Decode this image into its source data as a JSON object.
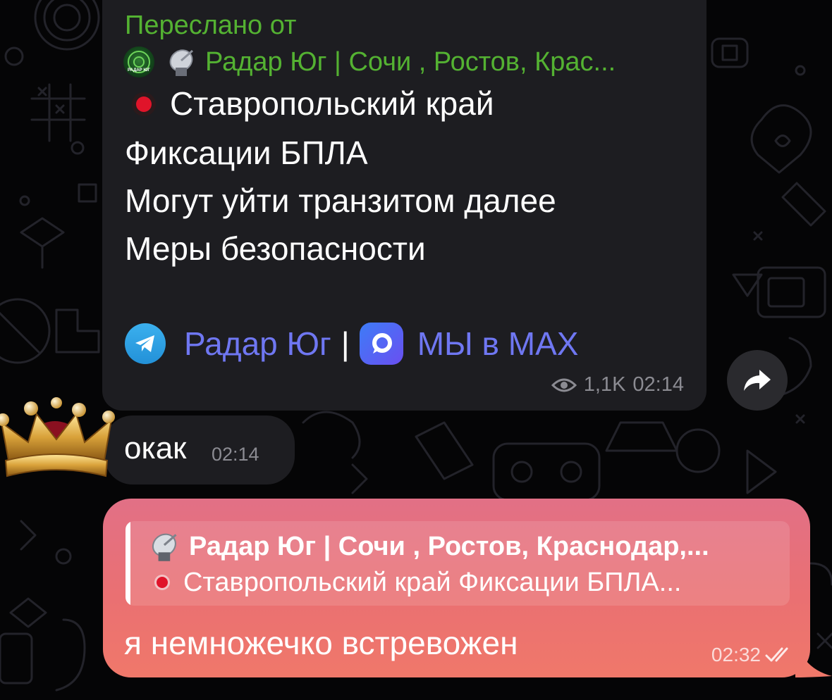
{
  "messages": {
    "forwarded": {
      "forwarded_label": "Переслано от",
      "source_name": "Радар Юг | Сочи , Ростов, Крас...",
      "source_avatar_caption": "РАДАР ЮГ",
      "lines": [
        "Ставропольский край",
        "Фиксации БПЛА",
        "Могут уйти транзитом далее",
        "Меры безопасности"
      ],
      "link_telegram": "Радар Юг",
      "link_separator": "|",
      "link_max": "МЫ в МАХ",
      "views": "1,1K",
      "time": "02:14"
    },
    "incoming_short": {
      "text": "окак",
      "time": "02:14"
    },
    "outgoing": {
      "reply_title": "Радар Юг | Сочи , Ростов, Краснодар,...",
      "reply_snippet": "Ставропольский край Фиксации БПЛА...",
      "text": "я немножечко встревожен",
      "time": "02:32",
      "status": "read"
    }
  },
  "colors": {
    "incoming_bubble": "#1d1d21",
    "outgoing_bubble_top": "#e27086",
    "outgoing_bubble_bottom": "#f0786a",
    "forward_green": "#54b232",
    "link_purple": "#6f77f2",
    "meta_gray": "#8b8b92"
  },
  "icons": {
    "share": "share-arrow-icon",
    "views": "eye-icon",
    "telegram": "telegram-icon",
    "max": "max-app-icon",
    "status": "double-check-icon",
    "avatar": "crown-avatar"
  }
}
